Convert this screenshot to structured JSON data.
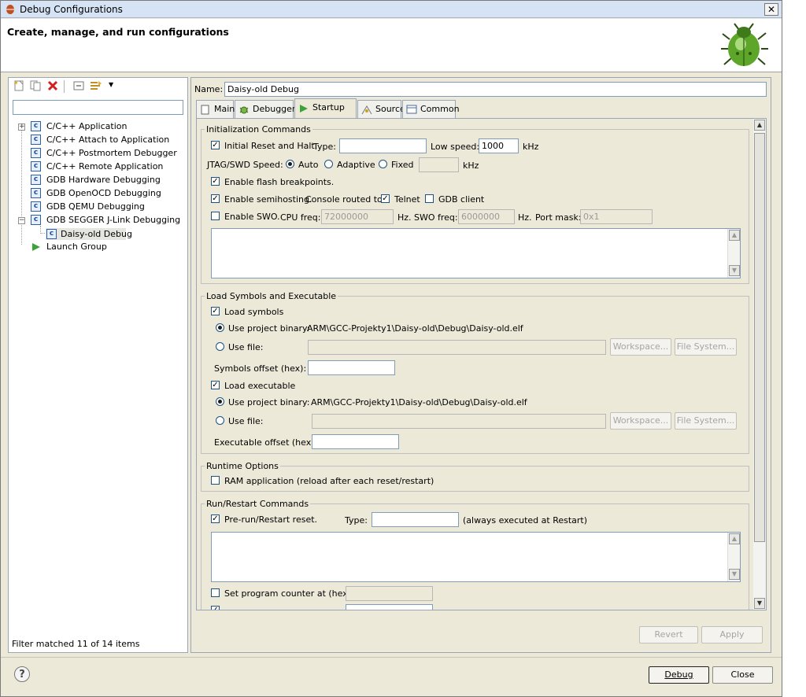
{
  "window": {
    "title": "Debug Configurations",
    "close": "✕"
  },
  "banner": {
    "title": "Create, manage, and run configurations"
  },
  "left": {
    "filter_placeholder": "",
    "tree": [
      {
        "label": "C/C++ Application",
        "expander": "+"
      },
      {
        "label": "C/C++ Attach to Application",
        "expander": ""
      },
      {
        "label": "C/C++ Postmortem Debugger",
        "expander": ""
      },
      {
        "label": "C/C++ Remote Application",
        "expander": ""
      },
      {
        "label": "GDB Hardware Debugging",
        "expander": ""
      },
      {
        "label": "GDB OpenOCD Debugging",
        "expander": ""
      },
      {
        "label": "GDB QEMU Debugging",
        "expander": ""
      },
      {
        "label": "GDB SEGGER J-Link Debugging",
        "expander": "−"
      },
      {
        "label": "Daisy-old Debug",
        "expander": ""
      },
      {
        "label": "Launch Group",
        "expander": ""
      }
    ],
    "status": "Filter matched 11 of 14 items"
  },
  "config": {
    "name_label": "Name:",
    "name_value": "Daisy-old Debug",
    "tabs": [
      "Main",
      "Debugger",
      "Startup",
      "Source",
      "Common"
    ]
  },
  "init": {
    "legend": "Initialization Commands",
    "reset_label": "Initial Reset and Halt.",
    "type_label": "Type:",
    "type_value": "",
    "lowspeed_label": "Low speed:",
    "lowspeed_value": "1000",
    "khz": "kHz",
    "jtag_label": "JTAG/SWD Speed:",
    "auto": "Auto",
    "adaptive": "Adaptive",
    "fixed": "Fixed",
    "fixed_value": "",
    "khz2": "kHz",
    "flash_label": "Enable flash breakpoints.",
    "semi_label": "Enable semihosting.",
    "console_label": "Console routed to:",
    "telnet": "Telnet",
    "gdbclient": "GDB client",
    "swo_label": "Enable SWO.",
    "cpu_label": "CPU freq:",
    "cpu_value": "72000000",
    "hz1": "Hz.",
    "swofreq_label": "SWO freq:",
    "swofreq_value": "6000000",
    "hz2": "Hz.",
    "portmask_label": "Port mask:",
    "portmask_value": "0x1"
  },
  "load": {
    "legend": "Load Symbols and Executable",
    "loadsym": "Load symbols",
    "useproj1": "Use project binary:",
    "path1": "ARM\\GCC-Projekty1\\Daisy-old\\Debug\\Daisy-old.elf",
    "usefile1": "Use file:",
    "workspace1": "Workspace...",
    "filesystem1": "File System...",
    "symoffset": "Symbols offset (hex):",
    "loadexe": "Load executable",
    "useproj2": "Use project binary:",
    "path2": "ARM\\GCC-Projekty1\\Daisy-old\\Debug\\Daisy-old.elf",
    "usefile2": "Use file:",
    "workspace2": "Workspace...",
    "filesystem2": "File System...",
    "exeoffset": "Executable offset (hex):"
  },
  "runtime": {
    "legend": "Runtime Options",
    "ram": "RAM application (reload after each reset/restart)"
  },
  "run": {
    "legend": "Run/Restart Commands",
    "prerun": "Pre-run/Restart reset.",
    "type_label": "Type:",
    "type_value": "",
    "always": "(always executed at Restart)",
    "setpc": "Set program counter at (hex):"
  },
  "buttons": {
    "revert": "Revert",
    "apply": "Apply",
    "debug": "Debug",
    "close": "Close",
    "help": "?"
  },
  "colors": {
    "accent": "#1c5180",
    "check": "#000000"
  }
}
